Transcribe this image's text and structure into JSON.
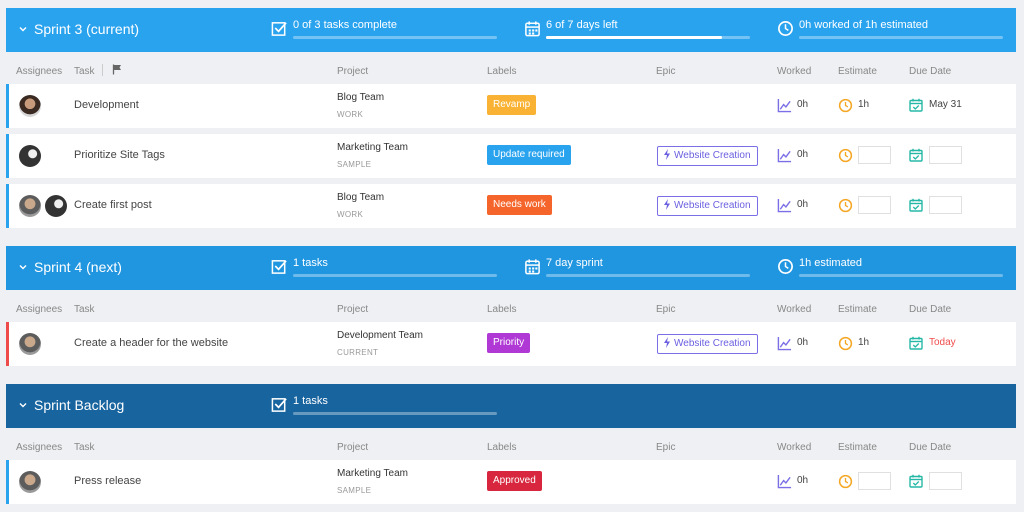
{
  "colors": {
    "sprint_current": "#2aa3ef",
    "sprint_next": "#2196e0",
    "backlog": "#17649f"
  },
  "columns": {
    "assignees": "Assignees",
    "task": "Task",
    "project": "Project",
    "labels": "Labels",
    "epic": "Epic",
    "worked": "Worked",
    "estimate": "Estimate",
    "due": "Due Date"
  },
  "sprints": [
    {
      "title": "Sprint 3 (current)",
      "tasks_stat": "0 of 3 tasks complete",
      "tasks_progress": 0,
      "days_stat": "6 of 7 days left",
      "days_progress": 0.86,
      "time_stat": "0h worked of 1h estimated",
      "time_progress": 0,
      "rows": [
        {
          "task": "Development",
          "project": "Blog Team",
          "project_sub": "WORK",
          "label": "Revamp",
          "label_color": "#f9b233",
          "epic": "",
          "worked": "0h",
          "estimate": "1h",
          "due": "May 31",
          "accent": "#2aa3ef"
        },
        {
          "task": "Prioritize Site Tags",
          "project": "Marketing Team",
          "project_sub": "SAMPLE",
          "label": "Update required",
          "label_color": "#2aa3ef",
          "epic": "Website Creation",
          "worked": "0h",
          "estimate": "",
          "due": "",
          "accent": "#2aa3ef"
        },
        {
          "task": "Create first post",
          "project": "Blog Team",
          "project_sub": "WORK",
          "label": "Needs work",
          "label_color": "#f5652b",
          "epic": "Website Creation",
          "worked": "0h",
          "estimate": "",
          "due": "",
          "accent": "#2aa3ef"
        }
      ]
    },
    {
      "title": "Sprint 4 (next)",
      "tasks_stat": "1 tasks",
      "tasks_progress": 0,
      "days_stat": "7 day sprint",
      "days_progress": 0,
      "time_stat": "1h estimated",
      "time_progress": 0,
      "rows": [
        {
          "task": "Create a header for the website",
          "project": "Development Team",
          "project_sub": "CURRENT",
          "label": "Priority",
          "label_color": "#b039d6",
          "epic": "Website Creation",
          "worked": "0h",
          "estimate": "1h",
          "due": "Today",
          "accent": "#f04b4b"
        }
      ]
    },
    {
      "title": "Sprint Backlog",
      "tasks_stat": "1 tasks",
      "tasks_progress": 0,
      "rows": [
        {
          "task": "Press release",
          "project": "Marketing Team",
          "project_sub": "SAMPLE",
          "label": "Approved",
          "label_color": "#d7263d",
          "epic": "",
          "worked": "0h",
          "estimate": "",
          "due": "",
          "accent": "#2aa3ef"
        }
      ]
    }
  ],
  "icons": [
    "chevron-down-icon",
    "checkbox-icon",
    "calendar-icon",
    "clock-icon",
    "flag-icon",
    "trend-chart-icon",
    "bolt-icon",
    "avatar"
  ]
}
